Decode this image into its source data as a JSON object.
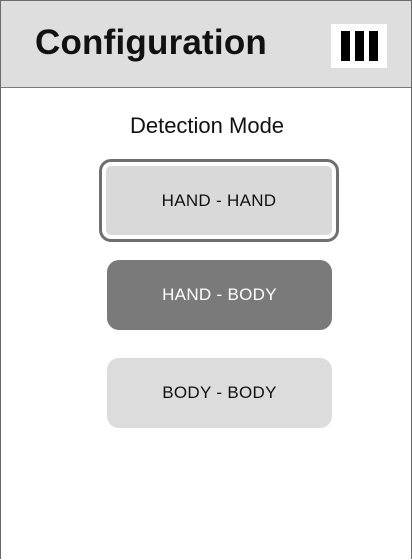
{
  "header": {
    "title": "Configuration",
    "menu_icon": "menu-bars-icon"
  },
  "detection": {
    "label": "Detection Mode",
    "options": [
      {
        "label": "HAND - HAND",
        "selected": true
      },
      {
        "label": "HAND - BODY",
        "selected": false
      },
      {
        "label": "BODY - BODY",
        "selected": false
      }
    ]
  },
  "colors": {
    "header_bg": "#dedede",
    "selected_bg": "#d9d9d9",
    "dark_button_bg": "#7a7a7a",
    "light_button_bg": "#dcdcdc"
  }
}
